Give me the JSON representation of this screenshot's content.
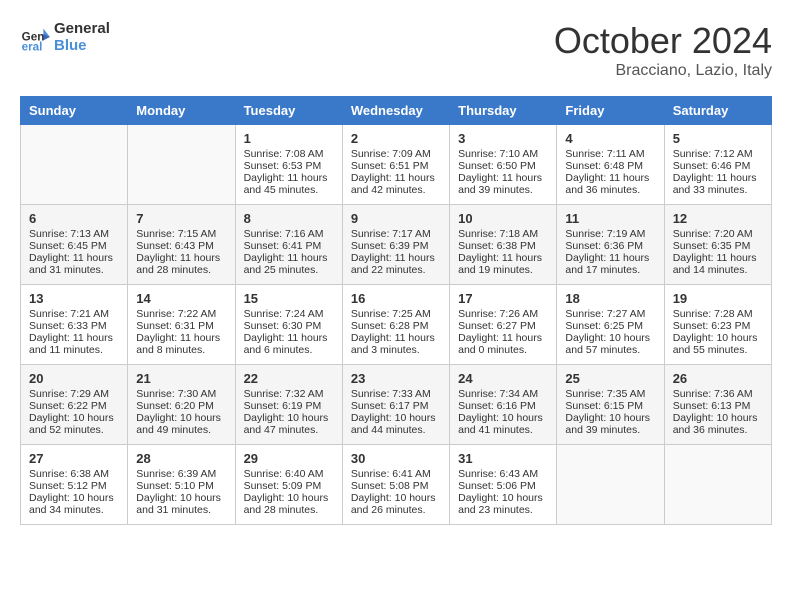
{
  "header": {
    "logo_line1": "General",
    "logo_line2": "Blue",
    "month_title": "October 2024",
    "location": "Bracciano, Lazio, Italy"
  },
  "days_of_week": [
    "Sunday",
    "Monday",
    "Tuesday",
    "Wednesday",
    "Thursday",
    "Friday",
    "Saturday"
  ],
  "weeks": [
    [
      {
        "num": "",
        "sunrise": "",
        "sunset": "",
        "daylight": ""
      },
      {
        "num": "",
        "sunrise": "",
        "sunset": "",
        "daylight": ""
      },
      {
        "num": "1",
        "sunrise": "Sunrise: 7:08 AM",
        "sunset": "Sunset: 6:53 PM",
        "daylight": "Daylight: 11 hours and 45 minutes."
      },
      {
        "num": "2",
        "sunrise": "Sunrise: 7:09 AM",
        "sunset": "Sunset: 6:51 PM",
        "daylight": "Daylight: 11 hours and 42 minutes."
      },
      {
        "num": "3",
        "sunrise": "Sunrise: 7:10 AM",
        "sunset": "Sunset: 6:50 PM",
        "daylight": "Daylight: 11 hours and 39 minutes."
      },
      {
        "num": "4",
        "sunrise": "Sunrise: 7:11 AM",
        "sunset": "Sunset: 6:48 PM",
        "daylight": "Daylight: 11 hours and 36 minutes."
      },
      {
        "num": "5",
        "sunrise": "Sunrise: 7:12 AM",
        "sunset": "Sunset: 6:46 PM",
        "daylight": "Daylight: 11 hours and 33 minutes."
      }
    ],
    [
      {
        "num": "6",
        "sunrise": "Sunrise: 7:13 AM",
        "sunset": "Sunset: 6:45 PM",
        "daylight": "Daylight: 11 hours and 31 minutes."
      },
      {
        "num": "7",
        "sunrise": "Sunrise: 7:15 AM",
        "sunset": "Sunset: 6:43 PM",
        "daylight": "Daylight: 11 hours and 28 minutes."
      },
      {
        "num": "8",
        "sunrise": "Sunrise: 7:16 AM",
        "sunset": "Sunset: 6:41 PM",
        "daylight": "Daylight: 11 hours and 25 minutes."
      },
      {
        "num": "9",
        "sunrise": "Sunrise: 7:17 AM",
        "sunset": "Sunset: 6:39 PM",
        "daylight": "Daylight: 11 hours and 22 minutes."
      },
      {
        "num": "10",
        "sunrise": "Sunrise: 7:18 AM",
        "sunset": "Sunset: 6:38 PM",
        "daylight": "Daylight: 11 hours and 19 minutes."
      },
      {
        "num": "11",
        "sunrise": "Sunrise: 7:19 AM",
        "sunset": "Sunset: 6:36 PM",
        "daylight": "Daylight: 11 hours and 17 minutes."
      },
      {
        "num": "12",
        "sunrise": "Sunrise: 7:20 AM",
        "sunset": "Sunset: 6:35 PM",
        "daylight": "Daylight: 11 hours and 14 minutes."
      }
    ],
    [
      {
        "num": "13",
        "sunrise": "Sunrise: 7:21 AM",
        "sunset": "Sunset: 6:33 PM",
        "daylight": "Daylight: 11 hours and 11 minutes."
      },
      {
        "num": "14",
        "sunrise": "Sunrise: 7:22 AM",
        "sunset": "Sunset: 6:31 PM",
        "daylight": "Daylight: 11 hours and 8 minutes."
      },
      {
        "num": "15",
        "sunrise": "Sunrise: 7:24 AM",
        "sunset": "Sunset: 6:30 PM",
        "daylight": "Daylight: 11 hours and 6 minutes."
      },
      {
        "num": "16",
        "sunrise": "Sunrise: 7:25 AM",
        "sunset": "Sunset: 6:28 PM",
        "daylight": "Daylight: 11 hours and 3 minutes."
      },
      {
        "num": "17",
        "sunrise": "Sunrise: 7:26 AM",
        "sunset": "Sunset: 6:27 PM",
        "daylight": "Daylight: 11 hours and 0 minutes."
      },
      {
        "num": "18",
        "sunrise": "Sunrise: 7:27 AM",
        "sunset": "Sunset: 6:25 PM",
        "daylight": "Daylight: 10 hours and 57 minutes."
      },
      {
        "num": "19",
        "sunrise": "Sunrise: 7:28 AM",
        "sunset": "Sunset: 6:23 PM",
        "daylight": "Daylight: 10 hours and 55 minutes."
      }
    ],
    [
      {
        "num": "20",
        "sunrise": "Sunrise: 7:29 AM",
        "sunset": "Sunset: 6:22 PM",
        "daylight": "Daylight: 10 hours and 52 minutes."
      },
      {
        "num": "21",
        "sunrise": "Sunrise: 7:30 AM",
        "sunset": "Sunset: 6:20 PM",
        "daylight": "Daylight: 10 hours and 49 minutes."
      },
      {
        "num": "22",
        "sunrise": "Sunrise: 7:32 AM",
        "sunset": "Sunset: 6:19 PM",
        "daylight": "Daylight: 10 hours and 47 minutes."
      },
      {
        "num": "23",
        "sunrise": "Sunrise: 7:33 AM",
        "sunset": "Sunset: 6:17 PM",
        "daylight": "Daylight: 10 hours and 44 minutes."
      },
      {
        "num": "24",
        "sunrise": "Sunrise: 7:34 AM",
        "sunset": "Sunset: 6:16 PM",
        "daylight": "Daylight: 10 hours and 41 minutes."
      },
      {
        "num": "25",
        "sunrise": "Sunrise: 7:35 AM",
        "sunset": "Sunset: 6:15 PM",
        "daylight": "Daylight: 10 hours and 39 minutes."
      },
      {
        "num": "26",
        "sunrise": "Sunrise: 7:36 AM",
        "sunset": "Sunset: 6:13 PM",
        "daylight": "Daylight: 10 hours and 36 minutes."
      }
    ],
    [
      {
        "num": "27",
        "sunrise": "Sunrise: 6:38 AM",
        "sunset": "Sunset: 5:12 PM",
        "daylight": "Daylight: 10 hours and 34 minutes."
      },
      {
        "num": "28",
        "sunrise": "Sunrise: 6:39 AM",
        "sunset": "Sunset: 5:10 PM",
        "daylight": "Daylight: 10 hours and 31 minutes."
      },
      {
        "num": "29",
        "sunrise": "Sunrise: 6:40 AM",
        "sunset": "Sunset: 5:09 PM",
        "daylight": "Daylight: 10 hours and 28 minutes."
      },
      {
        "num": "30",
        "sunrise": "Sunrise: 6:41 AM",
        "sunset": "Sunset: 5:08 PM",
        "daylight": "Daylight: 10 hours and 26 minutes."
      },
      {
        "num": "31",
        "sunrise": "Sunrise: 6:43 AM",
        "sunset": "Sunset: 5:06 PM",
        "daylight": "Daylight: 10 hours and 23 minutes."
      },
      {
        "num": "",
        "sunrise": "",
        "sunset": "",
        "daylight": ""
      },
      {
        "num": "",
        "sunrise": "",
        "sunset": "",
        "daylight": ""
      }
    ]
  ]
}
